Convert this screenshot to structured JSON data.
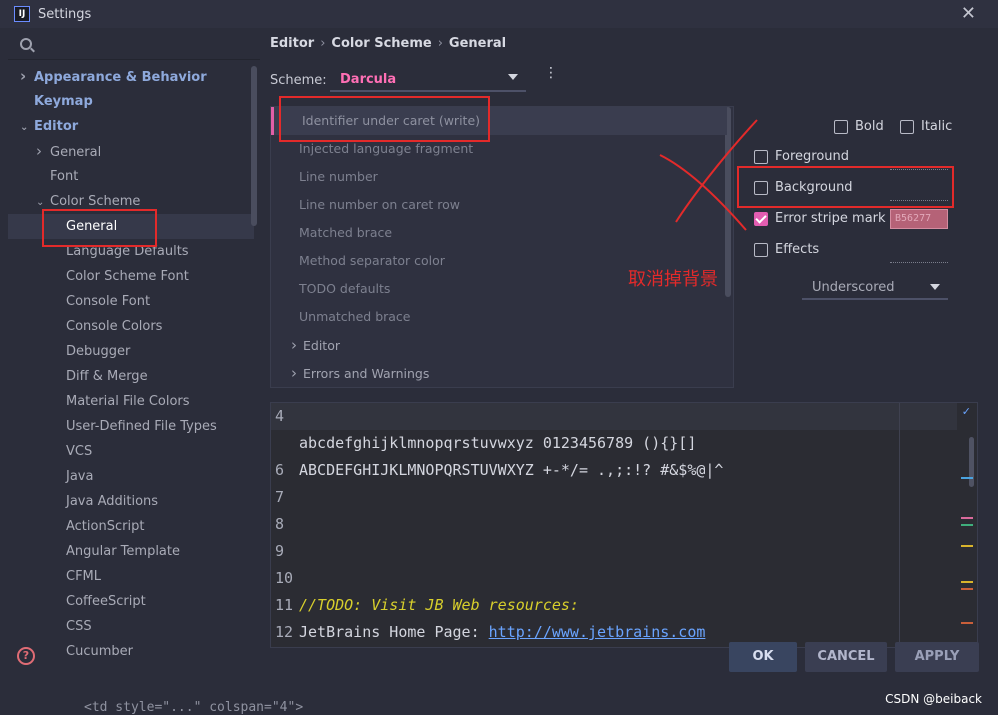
{
  "window": {
    "title": "Settings",
    "app_icon": "IJ"
  },
  "sidebar": {
    "items": [
      {
        "label": "Appearance & Behavior",
        "level": 0,
        "arrow": "right",
        "bold": true
      },
      {
        "label": "Keymap",
        "level": 0,
        "arrow": "",
        "bold": true
      },
      {
        "label": "Editor",
        "level": 0,
        "arrow": "down",
        "bold": true
      },
      {
        "label": "General",
        "level": 1,
        "arrow": "right"
      },
      {
        "label": "Font",
        "level": 1,
        "arrow": ""
      },
      {
        "label": "Color Scheme",
        "level": 1,
        "arrow": "down"
      },
      {
        "label": "General",
        "level": 2,
        "arrow": "",
        "selected": true
      },
      {
        "label": "Language Defaults",
        "level": 2,
        "arrow": ""
      },
      {
        "label": "Color Scheme Font",
        "level": 2,
        "arrow": ""
      },
      {
        "label": "Console Font",
        "level": 2,
        "arrow": ""
      },
      {
        "label": "Console Colors",
        "level": 2,
        "arrow": ""
      },
      {
        "label": "Debugger",
        "level": 2,
        "arrow": ""
      },
      {
        "label": "Diff & Merge",
        "level": 2,
        "arrow": ""
      },
      {
        "label": "Material File Colors",
        "level": 2,
        "arrow": ""
      },
      {
        "label": "User-Defined File Types",
        "level": 2,
        "arrow": ""
      },
      {
        "label": "VCS",
        "level": 2,
        "arrow": ""
      },
      {
        "label": "Java",
        "level": 2,
        "arrow": ""
      },
      {
        "label": "Java Additions",
        "level": 2,
        "arrow": ""
      },
      {
        "label": "ActionScript",
        "level": 2,
        "arrow": ""
      },
      {
        "label": "Angular Template",
        "level": 2,
        "arrow": ""
      },
      {
        "label": "CFML",
        "level": 2,
        "arrow": ""
      },
      {
        "label": "CoffeeScript",
        "level": 2,
        "arrow": ""
      },
      {
        "label": "CSS",
        "level": 2,
        "arrow": ""
      },
      {
        "label": "Cucumber",
        "level": 2,
        "arrow": ""
      }
    ]
  },
  "breadcrumb": [
    "Editor",
    "Color Scheme",
    "General"
  ],
  "scheme": {
    "label": "Scheme:",
    "value": "Darcula"
  },
  "elements": {
    "items": [
      {
        "label": "Identifier under caret (write)",
        "selected": true
      },
      {
        "label": "Injected language fragment"
      },
      {
        "label": "Line number"
      },
      {
        "label": "Line number on caret row"
      },
      {
        "label": "Matched brace"
      },
      {
        "label": "Method separator color"
      },
      {
        "label": "TODO defaults"
      },
      {
        "label": "Unmatched brace"
      },
      {
        "label": "Editor",
        "group": true
      },
      {
        "label": "Errors and Warnings",
        "group": true
      }
    ]
  },
  "options": {
    "bold": {
      "label": "Bold",
      "checked": false
    },
    "italic": {
      "label": "Italic",
      "checked": false
    },
    "foreground": {
      "label": "Foreground",
      "checked": false
    },
    "background": {
      "label": "Background",
      "checked": false
    },
    "error_stripe": {
      "label": "Error stripe mark",
      "checked": true,
      "color": "B56277"
    },
    "effects": {
      "label": "Effects",
      "checked": false,
      "style": "Underscored"
    }
  },
  "preview": {
    "lines": [
      {
        "n": "4",
        "parts": []
      },
      {
        "n": "",
        "parts": [
          {
            "t": "abcdefghijklmnopqrstuvwxyz 0123456789 (){}[]",
            "c": "code"
          }
        ]
      },
      {
        "n": "6",
        "parts": [
          {
            "t": "ABCDEFGHIJKLMNOPQRSTUVWXYZ +-*/= .,;:!? #&$%@|^",
            "c": "code"
          }
        ]
      },
      {
        "n": "7",
        "parts": []
      },
      {
        "n": "8",
        "parts": []
      },
      {
        "n": "9",
        "parts": []
      },
      {
        "n": "10",
        "parts": []
      },
      {
        "n": "11",
        "parts": [
          {
            "t": "//TODO: Visit JB Web resources:",
            "c": "todo"
          }
        ]
      },
      {
        "n": "12",
        "parts": [
          {
            "t": "JetBrains Home Page: ",
            "c": "code"
          },
          {
            "t": "http://www.jetbrains.com",
            "c": "link"
          }
        ]
      }
    ]
  },
  "buttons": {
    "ok": "OK",
    "cancel": "CANCEL",
    "apply": "APPLY"
  },
  "annotation": {
    "text": "取消掉背景"
  },
  "watermark": "CSDN @beiback",
  "footer_code": "<td style=\"...\" colspan=\"4\">",
  "colors": {
    "accent": "#e35db1",
    "scheme_name": "#ff6fb5",
    "annotation": "#e32a2a",
    "todo": "#d8cf2c",
    "link": "#6aa4ff"
  }
}
